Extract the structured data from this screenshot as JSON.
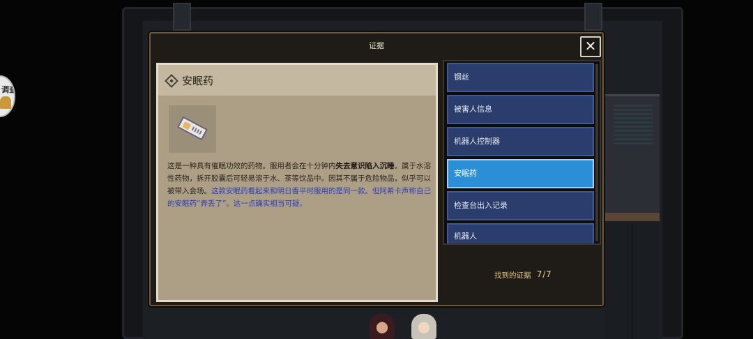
{
  "dialog": {
    "title": "证据",
    "close_glyph": "✕"
  },
  "left_hint": {
    "text": "调查"
  },
  "detail": {
    "name": "安眠药",
    "icon": "diamond-icon",
    "item_icon": "pill-pack-icon",
    "desc_1": "这是一种具有催眠功效的药物。服用者会在十分钟内",
    "desc_bold": "失去意识陷入沉睡",
    "desc_2": "。属于水溶性药物，拆开胶囊后可轻易溶于水、茶等饮品中。因其不属于危险物品，似乎可以被带入会场。",
    "desc_blue": "这款安眠药看起来和明日香平时服用的是同一款。但阿希卡声称自己的安眠药“弄丢了”。这一点确实相当可疑。"
  },
  "evidence_list": {
    "items": [
      {
        "label": "钢丝",
        "selected": false
      },
      {
        "label": "被害人信息",
        "selected": false
      },
      {
        "label": "机器人控制器",
        "selected": false
      },
      {
        "label": "安眠药",
        "selected": true
      },
      {
        "label": "检查台出入记录",
        "selected": false
      },
      {
        "label": "机器人",
        "selected": false
      }
    ]
  },
  "footer": {
    "found_label": "找到的证据",
    "found_count": "7/7"
  },
  "colors": {
    "selected_item": "#2d8ed8",
    "list_item": "#2a3d6c",
    "highlight_text": "#2b3fb8",
    "counter_text": "#f1d79f"
  }
}
